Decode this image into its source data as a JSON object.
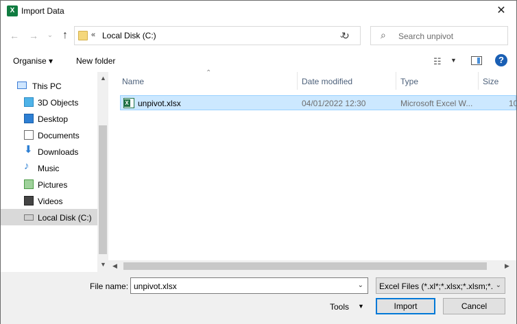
{
  "window": {
    "title": "Import Data",
    "app_icon_letter": "X"
  },
  "nav": {
    "back": "←",
    "forward": "→",
    "recent": "⌄",
    "up": "↑"
  },
  "address": {
    "chevrons": "«",
    "path": "Local Disk (C:)",
    "dropdown": "⌄"
  },
  "refresh_icon": "↻",
  "search": {
    "placeholder": "Search unpivot",
    "icon": "⌕"
  },
  "toolbar": {
    "organise": "Organise ▾",
    "new_folder": "New folder",
    "view_icon": "☷",
    "view_drop": "▼",
    "help": "?"
  },
  "sidebar": {
    "items": [
      {
        "label": "This PC",
        "icon": "monitor-icon"
      },
      {
        "label": "3D Objects",
        "icon": "cube-icon"
      },
      {
        "label": "Desktop",
        "icon": "desktop-icon"
      },
      {
        "label": "Documents",
        "icon": "documents-icon"
      },
      {
        "label": "Downloads",
        "icon": "download-icon"
      },
      {
        "label": "Music",
        "icon": "music-icon"
      },
      {
        "label": "Pictures",
        "icon": "pictures-icon"
      },
      {
        "label": "Videos",
        "icon": "videos-icon"
      },
      {
        "label": "Local Disk (C:)",
        "icon": "drive-icon"
      }
    ],
    "selected": "Local Disk (C:)"
  },
  "columns": {
    "name": "Name",
    "date": "Date modified",
    "type": "Type",
    "size": "Size",
    "sort": "⌃"
  },
  "files": [
    {
      "name": "unpivot.xlsx",
      "date": "04/01/2022 12:30",
      "type": "Microsoft Excel W...",
      "size": "10"
    }
  ],
  "footer": {
    "file_name_label": "File name:",
    "file_name_value": "unpivot.xlsx",
    "filter": "Excel Files (*.xl*;*.xlsx;*.xlsm;*.x",
    "tools": "Tools",
    "import": "Import",
    "cancel": "Cancel"
  },
  "colors": {
    "accent": "#0078d7",
    "selection": "#cce8ff",
    "excel_green": "#107c41"
  }
}
